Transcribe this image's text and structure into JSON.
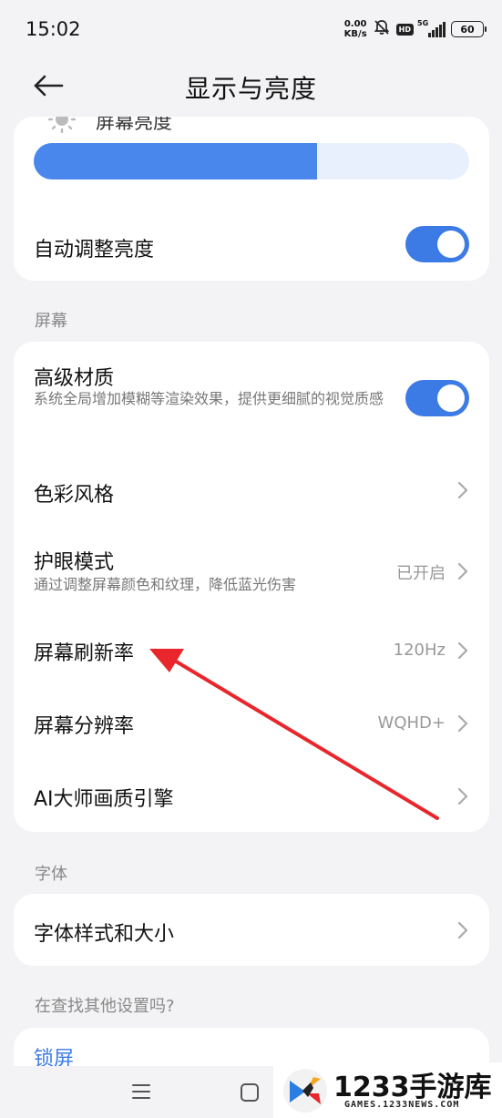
{
  "status_bar": {
    "time": "15:02",
    "net_speed_value": "0.00",
    "net_speed_unit": "KB/s",
    "hd_label": "HD",
    "network_type": "5G",
    "battery_level": "60"
  },
  "header": {
    "title": "显示与亮度"
  },
  "brightness": {
    "label": "屏幕亮度",
    "level": 0.65
  },
  "auto_brightness": {
    "label": "自动调整亮度",
    "enabled": true
  },
  "sections": {
    "screen_label": "屏幕",
    "font_label": "字体",
    "other_label": "在查找其他设置吗?"
  },
  "screen_items": [
    {
      "title": "高级材质",
      "subtitle": "系统全局增加模糊等渲染效果，提供更细腻的视觉质感",
      "toggle": true
    },
    {
      "title": "色彩风格"
    },
    {
      "title": "护眼模式",
      "subtitle": "通过调整屏幕颜色和纹理，降低蓝光伤害",
      "value": "已开启"
    },
    {
      "title": "屏幕刷新率",
      "value": "120Hz"
    },
    {
      "title": "屏幕分辨率",
      "value": "WQHD+"
    },
    {
      "title": "AI大师画质引擎"
    }
  ],
  "font_items": [
    {
      "title": "字体样式和大小"
    }
  ],
  "other_items": [
    {
      "title": "锁屏"
    }
  ],
  "colors": {
    "accent": "#3c7be6",
    "slider_fill": "#4a87ec",
    "annotation_arrow": "#e8262b"
  },
  "watermark": {
    "main": "1233手游库",
    "sub": "GAMES.1233NEWS.COM"
  }
}
